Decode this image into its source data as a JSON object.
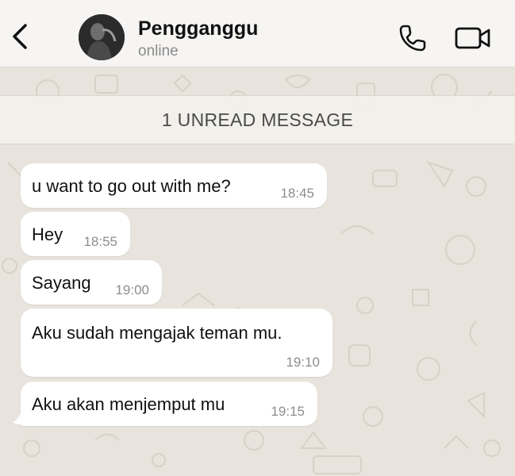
{
  "header": {
    "back_icon": "chevron-left-icon",
    "contact_name": "Pengganggu",
    "status": "online",
    "call_icon": "phone-icon",
    "video_icon": "video-camera-icon"
  },
  "chat": {
    "unread_banner": "1 UNREAD MESSAGE",
    "messages": [
      {
        "text": "u want to go out with me?",
        "time": "18:45"
      },
      {
        "text": "Hey",
        "time": "18:55"
      },
      {
        "text": "Sayang",
        "time": "19:00"
      },
      {
        "text": "Aku sudah mengajak teman mu.",
        "time": "19:10"
      },
      {
        "text": "Aku akan menjemput mu",
        "time": "19:15"
      }
    ]
  },
  "colors": {
    "bubble_incoming": "#ffffff",
    "header_bg": "#f6f5f3",
    "chat_bg": "#e8e3dc"
  }
}
